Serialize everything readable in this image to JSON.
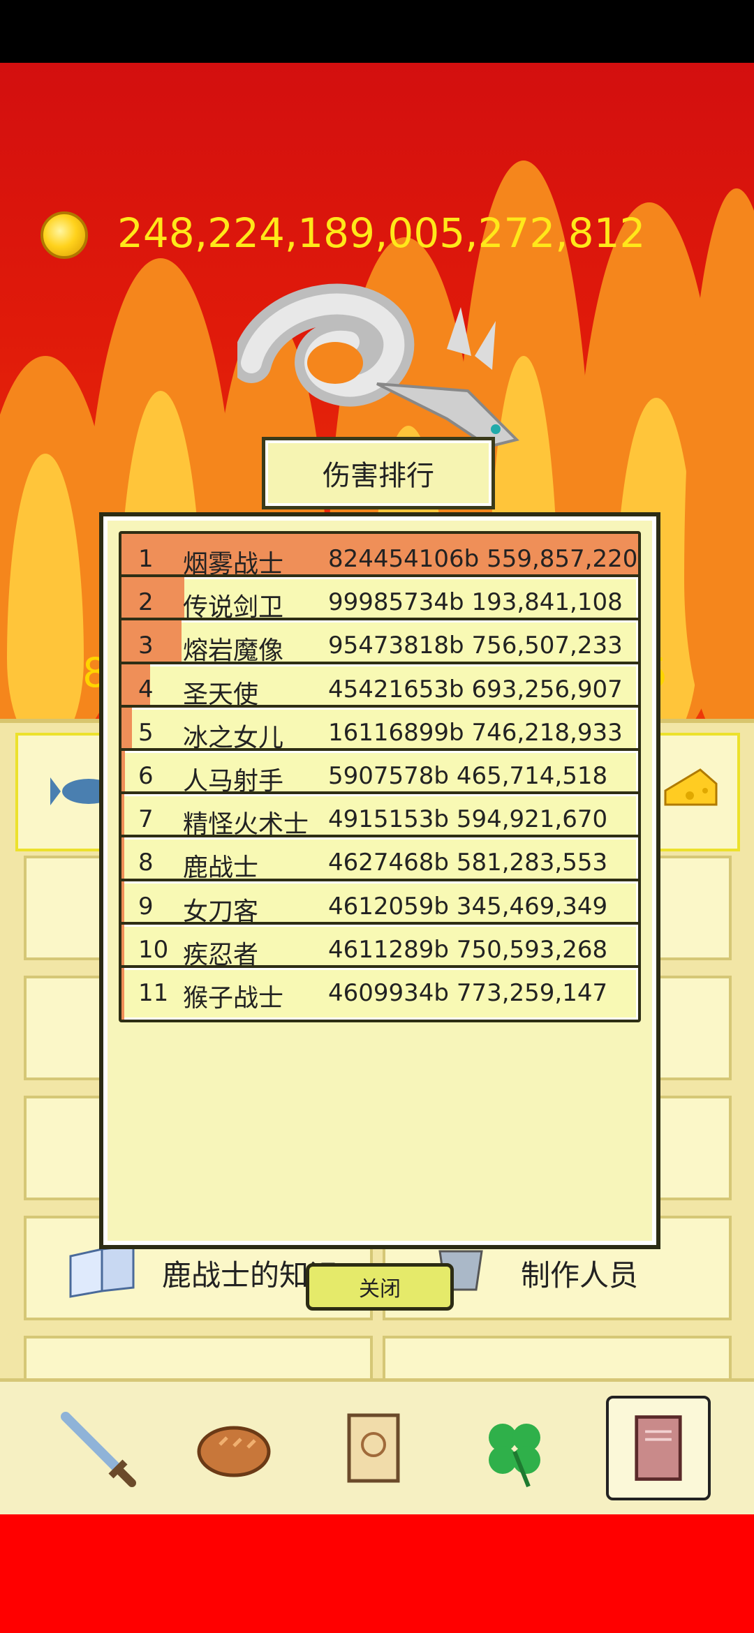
{
  "gold": {
    "amount": "248,224,189,005,272,812"
  },
  "background_numbers": {
    "left": "8",
    "right": "5"
  },
  "modal": {
    "title": "伤害排行",
    "close_label": "关闭",
    "rows": [
      {
        "rank": "1",
        "name": "烟雾战士",
        "damage": "824454106b 559,857,220",
        "share": 1.0
      },
      {
        "rank": "2",
        "name": "传说剑卫",
        "damage": "99985734b 193,841,108",
        "share": 0.121
      },
      {
        "rank": "3",
        "name": "熔岩魔像",
        "damage": "95473818b 756,507,233",
        "share": 0.116
      },
      {
        "rank": "4",
        "name": "圣天使",
        "damage": "45421653b 693,256,907",
        "share": 0.055
      },
      {
        "rank": "5",
        "name": "冰之女儿",
        "damage": "16116899b 746,218,933",
        "share": 0.02
      },
      {
        "rank": "6",
        "name": "人马射手",
        "damage": "5907578b 465,714,518",
        "share": 0.007
      },
      {
        "rank": "7",
        "name": "精怪火术士",
        "damage": "4915153b 594,921,670",
        "share": 0.006
      },
      {
        "rank": "8",
        "name": "鹿战士",
        "damage": "4627468b 581,283,553",
        "share": 0.006
      },
      {
        "rank": "9",
        "name": "女刀客",
        "damage": "4612059b 345,469,349",
        "share": 0.006
      },
      {
        "rank": "10",
        "name": "疾忍者",
        "damage": "4611289b 750,593,268",
        "share": 0.006
      },
      {
        "rank": "11",
        "name": "猴子战士",
        "damage": "4609934b 773,259,147",
        "share": 0.006
      }
    ]
  },
  "menu": {
    "knowledge_label": "鹿战士的知识",
    "credits_label": "制作人员"
  },
  "tabs": [
    {
      "icon": "sword-icon",
      "active": false
    },
    {
      "icon": "bread-icon",
      "active": false
    },
    {
      "icon": "scroll-icon",
      "active": false
    },
    {
      "icon": "clover-icon",
      "active": false
    },
    {
      "icon": "book-icon",
      "active": true
    }
  ],
  "colors": {
    "fill": "#ef8f58",
    "row_bg": "#f8f9b4",
    "gold_text": "#ffe81a"
  }
}
